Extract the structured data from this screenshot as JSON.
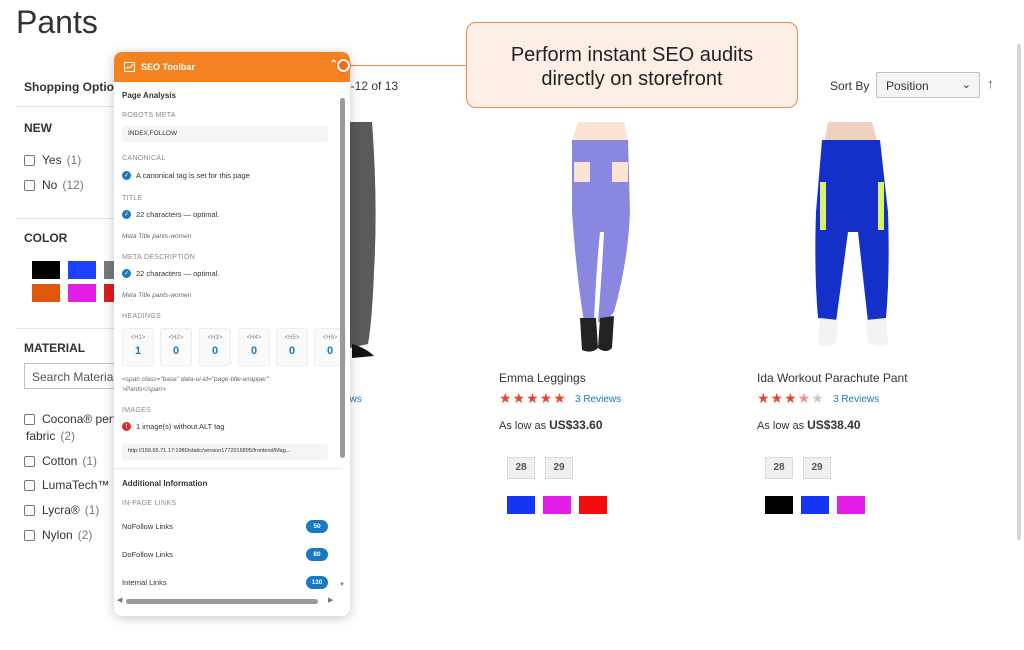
{
  "page": {
    "title": "Pants"
  },
  "sidebar": {
    "heading": "Shopping Options",
    "new": {
      "title": "NEW",
      "options": [
        {
          "label": "Yes",
          "count": "(1)"
        },
        {
          "label": "No",
          "count": "(12)"
        }
      ]
    },
    "color": {
      "title": "COLOR",
      "swatches": [
        "#000000",
        "#1e40ff",
        "#7a7a7a",
        "#e0570a",
        "#e31ee6",
        "#e01b1b"
      ]
    },
    "material": {
      "title": "MATERIAL",
      "search_placeholder": "Search Material",
      "options": [
        {
          "label_line1": "Cocona® perf",
          "label_line2": "fabric",
          "count": "(2)"
        },
        {
          "label": "Cotton",
          "count": "(1)"
        },
        {
          "label": "LumaTech™",
          "count": "("
        },
        {
          "label": "Lycra®",
          "count": "(1)"
        },
        {
          "label": "Nylon",
          "count": "(2)"
        }
      ]
    }
  },
  "toolbar": {
    "count_text": "1-12 of 13",
    "sort_label": "Sort By",
    "sort_value": "Position",
    "sort_dir_icon": "↑"
  },
  "products": [
    {
      "name": "",
      "reviews": "ews",
      "image": "grey-leggings"
    },
    {
      "name": "Emma Leggings",
      "rating": 4.5,
      "reviews": "3  Reviews",
      "price_prefix": "As low as",
      "price": "US$33.60",
      "sizes": [
        "28",
        "29"
      ],
      "colors": [
        "#1535f5",
        "#e31ee6",
        "#f20d0d"
      ],
      "image": "lavender-leggings"
    },
    {
      "name": "Ida Workout Parachute Pant",
      "rating": 3.5,
      "reviews": "3  Reviews",
      "price_prefix": "As low as",
      "price": "US$38.40",
      "sizes": [
        "28",
        "29"
      ],
      "colors": [
        "#000000",
        "#1535f5",
        "#e31ee6"
      ],
      "image": "blue-parachute-pant"
    }
  ],
  "seo": {
    "header": "SEO Toolbar",
    "section_title": "Page Analysis",
    "robots": {
      "label": "ROBOTS META",
      "value": "INDEX,FOLLOW"
    },
    "canonical": {
      "label": "CANONICAL",
      "text": "A canonical tag is set for this page"
    },
    "title": {
      "label": "TITLE",
      "text": "22 characters — optimal.",
      "meta": "Meta Title pants-women"
    },
    "description": {
      "label": "META DESCRIPTION",
      "text": "22 characters — optimal.",
      "meta": "Meta Title pants-women"
    },
    "headings": {
      "label": "HEADINGS",
      "items": [
        {
          "tag": "<H1>",
          "value": "1"
        },
        {
          "tag": "<H2>",
          "value": "0"
        },
        {
          "tag": "<H3>",
          "value": "0"
        },
        {
          "tag": "<H4>",
          "value": "0"
        },
        {
          "tag": "<H5>",
          "value": "0"
        },
        {
          "tag": "<H6>",
          "value": "0"
        }
      ],
      "code_line1": "<span class=\"base\" data-ui-id=\"page-title-wrapper\"",
      "code_line2": ">Pants</span>"
    },
    "images": {
      "label": "IMAGES",
      "text": "1 image(s) without ALT tag",
      "url": "http://159.65.71.17:1980/static/version1772016895/frontend/Mag..."
    },
    "additional": {
      "title": "Additional Information",
      "links_label": "IN-PAGE LINKS"
    },
    "links": [
      {
        "label": "NoFollow Links",
        "count": "50"
      },
      {
        "label": "DoFollow Links",
        "count": "80"
      },
      {
        "label": "Internal Links",
        "count": "130"
      }
    ]
  },
  "callout": {
    "line1": "Perform instant SEO audits",
    "line2": "directly on storefront"
  }
}
